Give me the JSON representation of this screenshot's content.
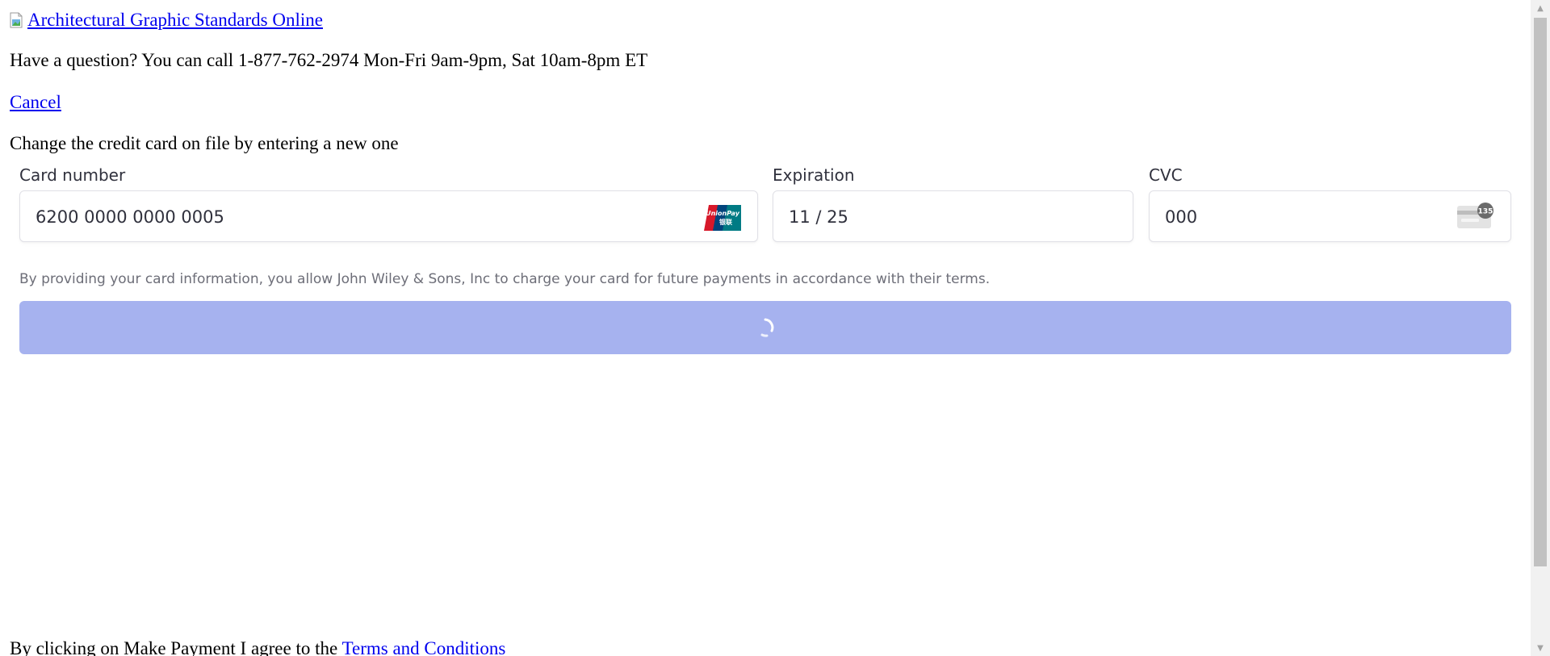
{
  "header": {
    "logo_alt": "Architectural Graphic Standards Online",
    "help_text": "Have a question? You can call 1-877-762-2974 Mon-Fri 9am-9pm, Sat 10am-8pm ET",
    "cancel_label": "Cancel",
    "instruction": "Change the credit card on file by entering a new one"
  },
  "payment": {
    "card_number_label": "Card number",
    "card_number_value": "6200 0000 0000 0005",
    "card_brand_icon": "unionpay-icon",
    "card_brand_text": "UnionPay",
    "card_brand_subtext": "银联",
    "expiration_label": "Expiration",
    "expiration_value": "11 / 25",
    "cvc_label": "CVC",
    "cvc_value": "000",
    "cvc_icon": "cvc-card-icon",
    "cvc_badge": "135",
    "terms_note": "By providing your card information, you allow John Wiley & Sons, Inc to charge your card for future payments in accordance with their terms.",
    "button_state": "loading",
    "button_color": "#a6b2ef"
  },
  "footer": {
    "agree_prefix": "By clicking on Make Payment I agree to the ",
    "terms_link": "Terms and Conditions"
  },
  "scrollbar": {
    "up_arrow": "▲",
    "down_arrow": "▼"
  }
}
